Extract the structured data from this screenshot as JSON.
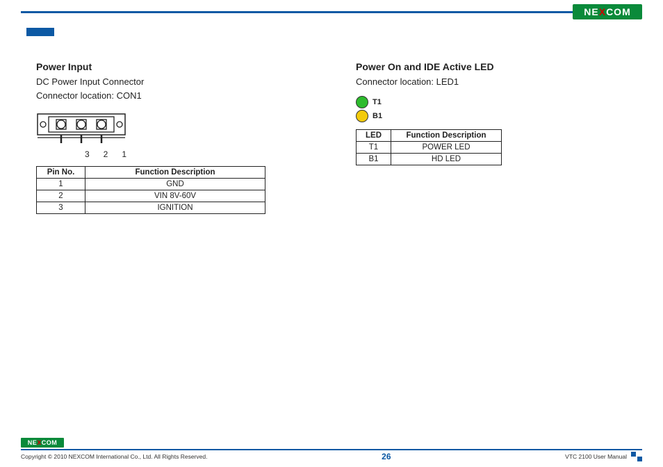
{
  "brand": {
    "pre": "NE",
    "x": "X",
    "post": "COM"
  },
  "left": {
    "title": "Power Input",
    "sub1": "DC Power Input Connector",
    "sub2": "Connector location: CON1",
    "pins": {
      "p3": "3",
      "p2": "2",
      "p1": "1"
    },
    "table": {
      "h1": "Pin  No.",
      "h2": "Function Description",
      "rows": [
        {
          "c1": "1",
          "c2": "GND"
        },
        {
          "c1": "2",
          "c2": "VIN 8V-60V"
        },
        {
          "c1": "3",
          "c2": "IGNITION"
        }
      ]
    }
  },
  "right": {
    "title": "Power On and IDE Active LED",
    "sub1": "Connector location: LED1",
    "leds": {
      "t1": "T1",
      "b1": "B1"
    },
    "table": {
      "h1": "LED",
      "h2": "Function Description",
      "rows": [
        {
          "c1": "T1",
          "c2": "POWER LED"
        },
        {
          "c1": "B1",
          "c2": "HD LED"
        }
      ]
    }
  },
  "footer": {
    "copyright": "Copyright © 2010 NEXCOM International Co., Ltd. All Rights Reserved.",
    "page": "26",
    "doc": "VTC 2100 User Manual"
  }
}
